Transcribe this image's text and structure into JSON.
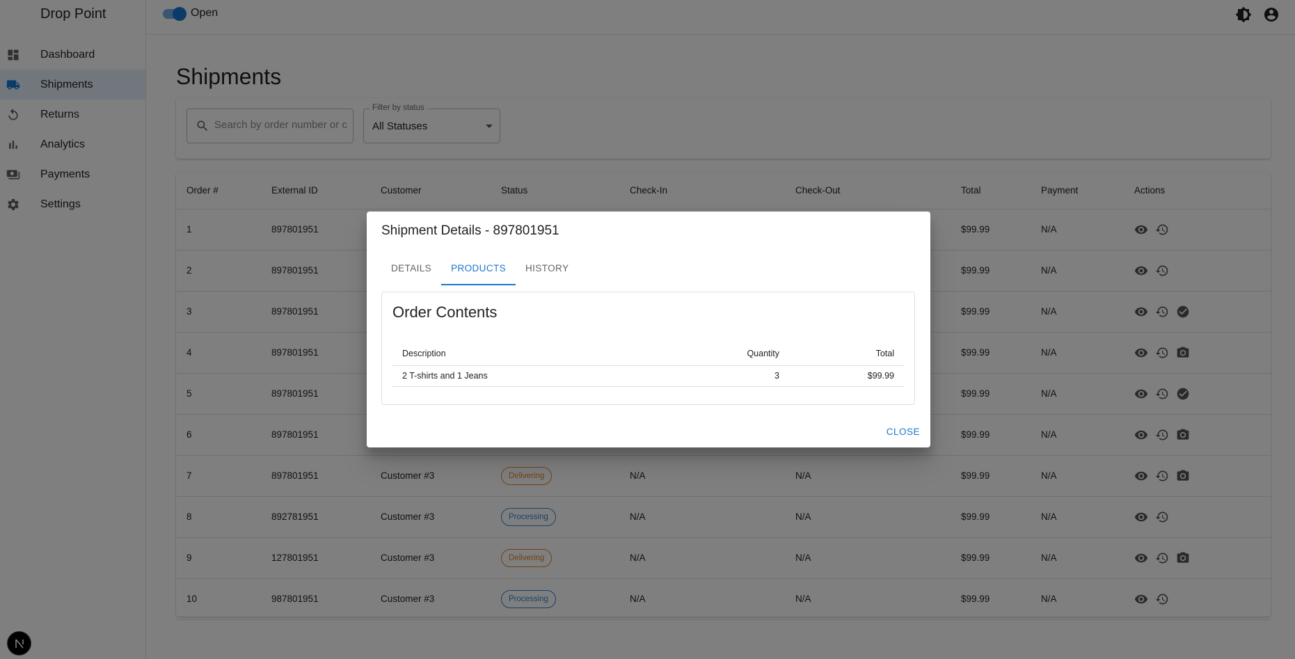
{
  "app": {
    "brand": "Drop Point"
  },
  "topbar": {
    "switch_label": "Open",
    "theme_icon": "theme-toggle-icon",
    "account_icon": "account-icon"
  },
  "sidebar": {
    "items": [
      {
        "label": "Dashboard",
        "icon": "dashboard-icon"
      },
      {
        "label": "Shipments",
        "icon": "truck-icon",
        "active": true
      },
      {
        "label": "Returns",
        "icon": "undo-icon"
      },
      {
        "label": "Analytics",
        "icon": "bar-chart-icon"
      },
      {
        "label": "Payments",
        "icon": "payments-icon"
      },
      {
        "label": "Settings",
        "icon": "gear-icon"
      }
    ]
  },
  "page": {
    "title": "Shipments"
  },
  "filters": {
    "search_placeholder": "Search by order number or c",
    "status_legend": "Filter by status",
    "status_value": "All Statuses"
  },
  "table": {
    "headers": [
      "Order #",
      "External ID",
      "Customer",
      "Status",
      "Check-In",
      "Check-Out",
      "Total",
      "Payment",
      "Actions"
    ],
    "rows": [
      {
        "order": "1",
        "ext": "897801951",
        "customer": "",
        "status": "",
        "checkin": "",
        "checkout": "",
        "total": "$99.99",
        "payment": "N/A",
        "actions": [
          "view",
          "history"
        ]
      },
      {
        "order": "2",
        "ext": "897801951",
        "customer": "",
        "status": "",
        "checkin": "",
        "checkout": "",
        "total": "$99.99",
        "payment": "N/A",
        "actions": [
          "view",
          "history"
        ]
      },
      {
        "order": "3",
        "ext": "897801951",
        "customer": "",
        "status": "",
        "checkin": "",
        "checkout": "",
        "total": "$99.99",
        "payment": "N/A",
        "actions": [
          "view",
          "history",
          "check"
        ]
      },
      {
        "order": "4",
        "ext": "897801951",
        "customer": "",
        "status": "",
        "checkin": "",
        "checkout": "",
        "total": "$99.99",
        "payment": "N/A",
        "actions": [
          "view",
          "history",
          "camera"
        ]
      },
      {
        "order": "5",
        "ext": "897801951",
        "customer": "",
        "status": "",
        "checkin": "",
        "checkout": "",
        "total": "$99.99",
        "payment": "N/A",
        "actions": [
          "view",
          "history",
          "check"
        ]
      },
      {
        "order": "6",
        "ext": "897801951",
        "customer": "",
        "status": "",
        "checkin": "",
        "checkout": "",
        "total": "$99.99",
        "payment": "N/A",
        "actions": [
          "view",
          "history",
          "camera"
        ]
      },
      {
        "order": "7",
        "ext": "897801951",
        "customer": "Customer #3",
        "status": "Delivering",
        "checkin": "N/A",
        "checkout": "N/A",
        "total": "$99.99",
        "payment": "N/A",
        "actions": [
          "view",
          "history",
          "camera"
        ]
      },
      {
        "order": "8",
        "ext": "892781951",
        "customer": "Customer #3",
        "status": "Processing",
        "checkin": "N/A",
        "checkout": "N/A",
        "total": "$99.99",
        "payment": "N/A",
        "actions": [
          "view",
          "history"
        ]
      },
      {
        "order": "9",
        "ext": "127801951",
        "customer": "Customer #3",
        "status": "Delivering",
        "checkin": "N/A",
        "checkout": "N/A",
        "total": "$99.99",
        "payment": "N/A",
        "actions": [
          "view",
          "history",
          "camera"
        ]
      },
      {
        "order": "10",
        "ext": "987801951",
        "customer": "Customer #3",
        "status": "Processing",
        "checkin": "N/A",
        "checkout": "N/A",
        "total": "$99.99",
        "payment": "N/A",
        "actions": [
          "view",
          "history"
        ]
      }
    ]
  },
  "dialog": {
    "title": "Shipment Details - 897801951",
    "tabs": [
      {
        "label": "DETAILS"
      },
      {
        "label": "PRODUCTS",
        "active": true
      },
      {
        "label": "HISTORY"
      }
    ],
    "contents_title": "Order Contents",
    "columns": {
      "description": "Description",
      "quantity": "Quantity",
      "total": "Total"
    },
    "items": [
      {
        "description": "2 T-shirts and 1 Jeans",
        "quantity": "3",
        "total": "$99.99"
      }
    ],
    "close_label": "CLOSE"
  },
  "colors": {
    "primary": "#1976d2",
    "delivering": "#e0852c",
    "processing": "#2f86d4"
  }
}
